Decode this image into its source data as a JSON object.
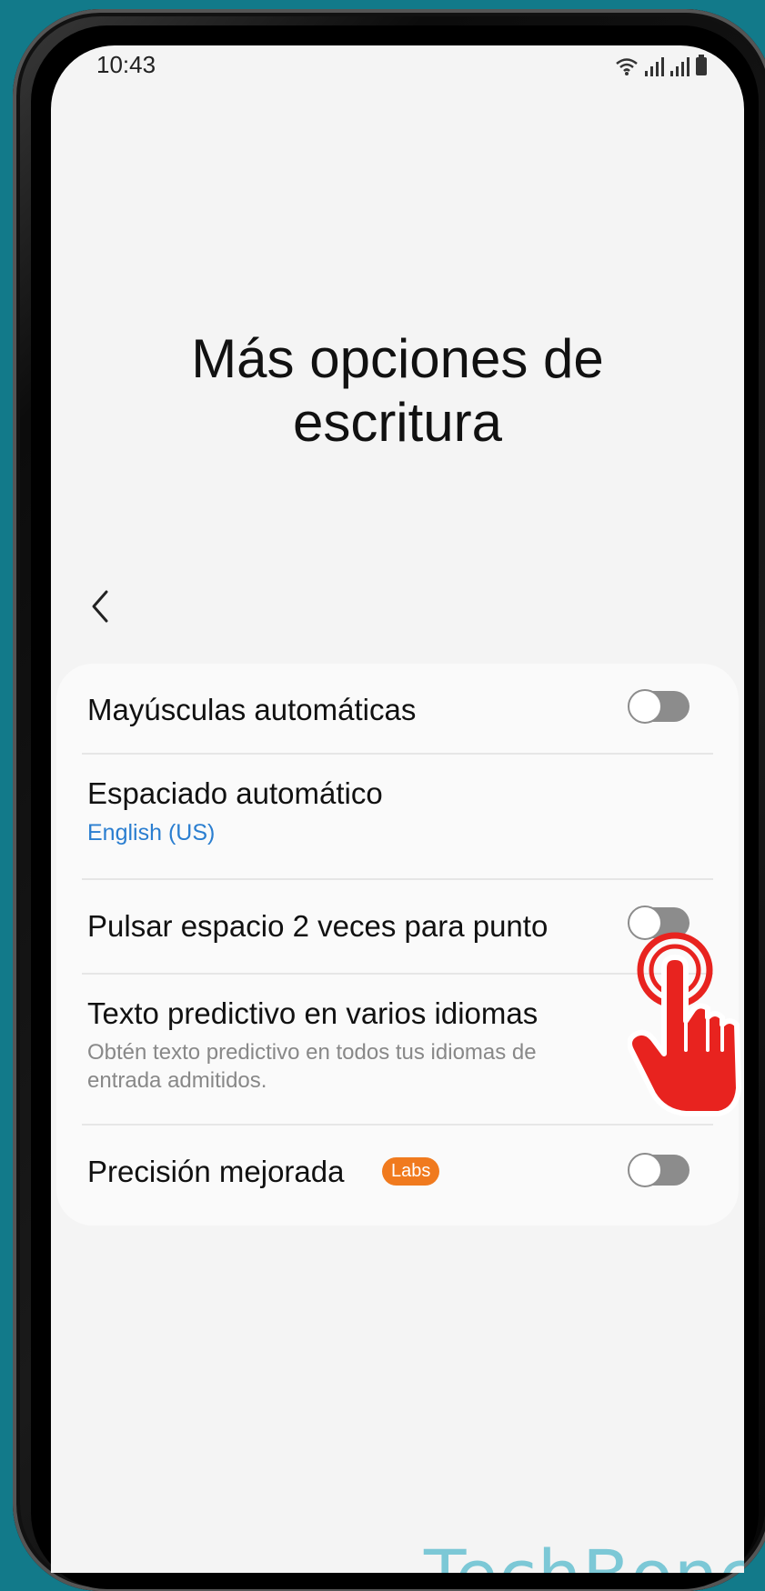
{
  "status_bar": {
    "time": "10:43"
  },
  "page": {
    "title_line1": "Más opciones de",
    "title_line2": "escritura"
  },
  "settings": [
    {
      "title": "Mayúsculas automáticas",
      "toggle": "off"
    },
    {
      "title": "Espaciado automático",
      "subtitle": "English (US)"
    },
    {
      "title": "Pulsar espacio 2 veces para punto",
      "toggle": "off"
    },
    {
      "title": "Texto predictivo en varios idiomas",
      "description": "Obtén texto predictivo en todos tus idiomas de entrada admitidos."
    },
    {
      "title": "Precisión mejorada",
      "badge": "Labs",
      "toggle": "off"
    }
  ],
  "watermark": "TechBone",
  "colors": {
    "background": "#127a8a",
    "accent_blue": "#2a7ed0",
    "badge_orange": "#f07a1e",
    "hand_red": "#e8231f",
    "watermark": "#7cc8d6"
  },
  "icons": [
    "wifi-icon",
    "signal-icon",
    "battery-icon",
    "back-arrow-icon",
    "tap-hand-icon"
  ]
}
